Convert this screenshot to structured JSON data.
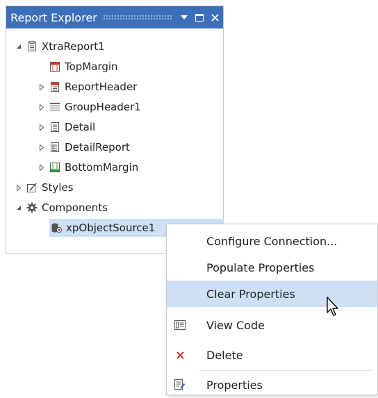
{
  "panel": {
    "title": "Report Explorer",
    "controls": [
      "dropdown-icon",
      "maximize-icon",
      "close-icon"
    ]
  },
  "tree": {
    "items": [
      {
        "label": "XtraReport1",
        "icon": "report-icon",
        "expanded": true
      },
      {
        "label": "TopMargin",
        "icon": "top-margin-icon"
      },
      {
        "label": "ReportHeader",
        "icon": "report-header-icon"
      },
      {
        "label": "GroupHeader1",
        "icon": "group-header-icon"
      },
      {
        "label": "Detail",
        "icon": "detail-icon"
      },
      {
        "label": "DetailReport",
        "icon": "detail-report-icon"
      },
      {
        "label": "BottomMargin",
        "icon": "bottom-margin-icon"
      },
      {
        "label": "Styles",
        "icon": "styles-icon"
      },
      {
        "label": "Components",
        "icon": "gear-icon",
        "expanded": true
      },
      {
        "label": "xpObjectSource1",
        "icon": "object-source-icon",
        "selected": true
      }
    ]
  },
  "context_menu": {
    "items": [
      {
        "label": "Configure Connection...",
        "icon": ""
      },
      {
        "label": "Populate Properties",
        "icon": ""
      },
      {
        "label": "Clear Properties",
        "icon": "",
        "hovered": true
      },
      {
        "label": "View Code",
        "icon": "view-code-icon"
      },
      {
        "label": "Delete",
        "icon": "delete-icon"
      },
      {
        "label": "Properties",
        "icon": "properties-icon"
      }
    ]
  },
  "colors": {
    "titlebar": "#3c6fb9",
    "selection": "#cde0f5",
    "delete": "#c0392b"
  }
}
